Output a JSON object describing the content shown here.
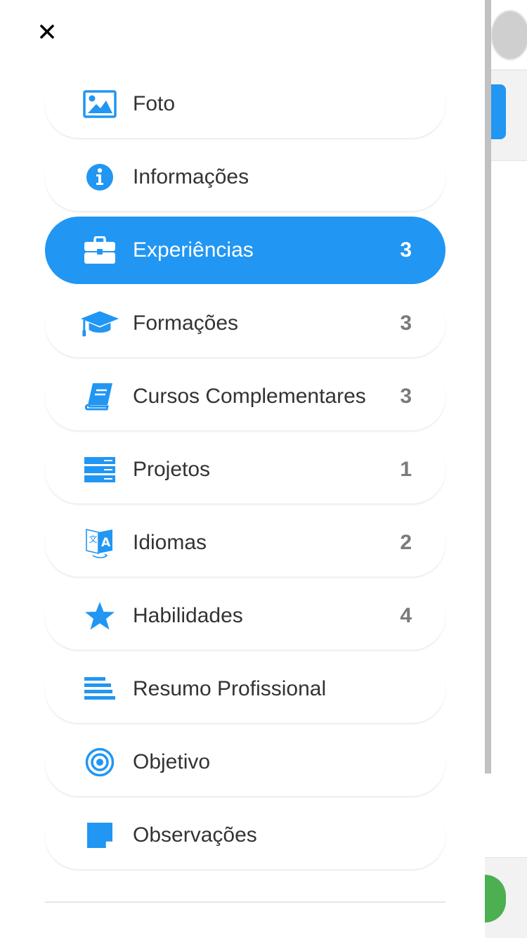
{
  "colors": {
    "accent": "#2196f3",
    "text": "#333333",
    "count": "#7a7a7a",
    "active_text": "#ffffff"
  },
  "close_icon": "×",
  "menu": [
    {
      "label": "Foto",
      "count": "",
      "icon": "image-icon",
      "active": false
    },
    {
      "label": "Informações",
      "count": "",
      "icon": "info-icon",
      "active": false
    },
    {
      "label": "Experiências",
      "count": "3",
      "icon": "briefcase-icon",
      "active": true
    },
    {
      "label": "Formações",
      "count": "3",
      "icon": "graduation-cap-icon",
      "active": false
    },
    {
      "label": "Cursos Complementares",
      "count": "3",
      "icon": "book-icon",
      "active": false
    },
    {
      "label": "Projetos",
      "count": "1",
      "icon": "server-icon",
      "active": false
    },
    {
      "label": "Idiomas",
      "count": "2",
      "icon": "language-icon",
      "active": false
    },
    {
      "label": "Habilidades",
      "count": "4",
      "icon": "star-icon",
      "active": false
    },
    {
      "label": "Resumo Profissional",
      "count": "",
      "icon": "align-left-icon",
      "active": false
    },
    {
      "label": "Objetivo",
      "count": "",
      "icon": "target-icon",
      "active": false
    },
    {
      "label": "Observações",
      "count": "",
      "icon": "sticky-note-icon",
      "active": false
    }
  ]
}
